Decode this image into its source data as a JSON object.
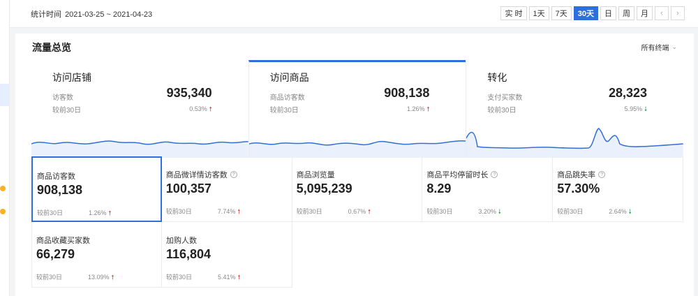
{
  "topbar": {
    "stat_label": "统计时间",
    "date_range": "2021-03-25 ~ 2021-04-23",
    "ranges": [
      "实 时",
      "1天",
      "7天",
      "30天",
      "日",
      "周",
      "月"
    ],
    "active_range": "30天",
    "prev_icon": "chevron-left-icon",
    "next_icon": "chevron-right-icon"
  },
  "panel": {
    "title": "流量总览",
    "terminal_select": "所有终端"
  },
  "cards": [
    {
      "title": "访问店铺",
      "sub": "访客数",
      "value": "935,340",
      "compare": "较前30日",
      "pct": "0.53%",
      "trend": "up"
    },
    {
      "title": "访问商品",
      "sub": "商品访客数",
      "value": "908,138",
      "compare": "较前30日",
      "pct": "1.26%",
      "trend": "up"
    },
    {
      "title": "转化",
      "sub": "支付买家数",
      "value": "28,323",
      "compare": "较前30日",
      "pct": "5.95%",
      "trend": "down"
    }
  ],
  "metrics": [
    {
      "label": "商品访客数",
      "value": "908,138",
      "compare": "较前30日",
      "pct": "1.26%",
      "trend": "up",
      "info": false
    },
    {
      "label": "商品微详情访客数",
      "value": "100,357",
      "compare": "较前30日",
      "pct": "7.74%",
      "trend": "up",
      "info": true
    },
    {
      "label": "商品浏览量",
      "value": "5,095,239",
      "compare": "较前30日",
      "pct": "0.67%",
      "trend": "up",
      "info": false
    },
    {
      "label": "商品平均停留时长",
      "value": "8.29",
      "compare": "较前30日",
      "pct": "3.20%",
      "trend": "down",
      "info": true
    },
    {
      "label": "商品跳失率",
      "value": "57.30%",
      "compare": "较前30日",
      "pct": "2.64%",
      "trend": "down",
      "info": true
    },
    {
      "label": "商品收藏买家数",
      "value": "66,279",
      "compare": "较前30日",
      "pct": "13.09%",
      "trend": "up",
      "info": false
    },
    {
      "label": "加购人数",
      "value": "116,804",
      "compare": "较前30日",
      "pct": "5.41%",
      "trend": "up",
      "info": false
    }
  ],
  "colors": {
    "accent": "#2f6fd9",
    "up": "#e53935",
    "down": "#1e9e4e",
    "spark_fill": "#eaf1fd"
  }
}
